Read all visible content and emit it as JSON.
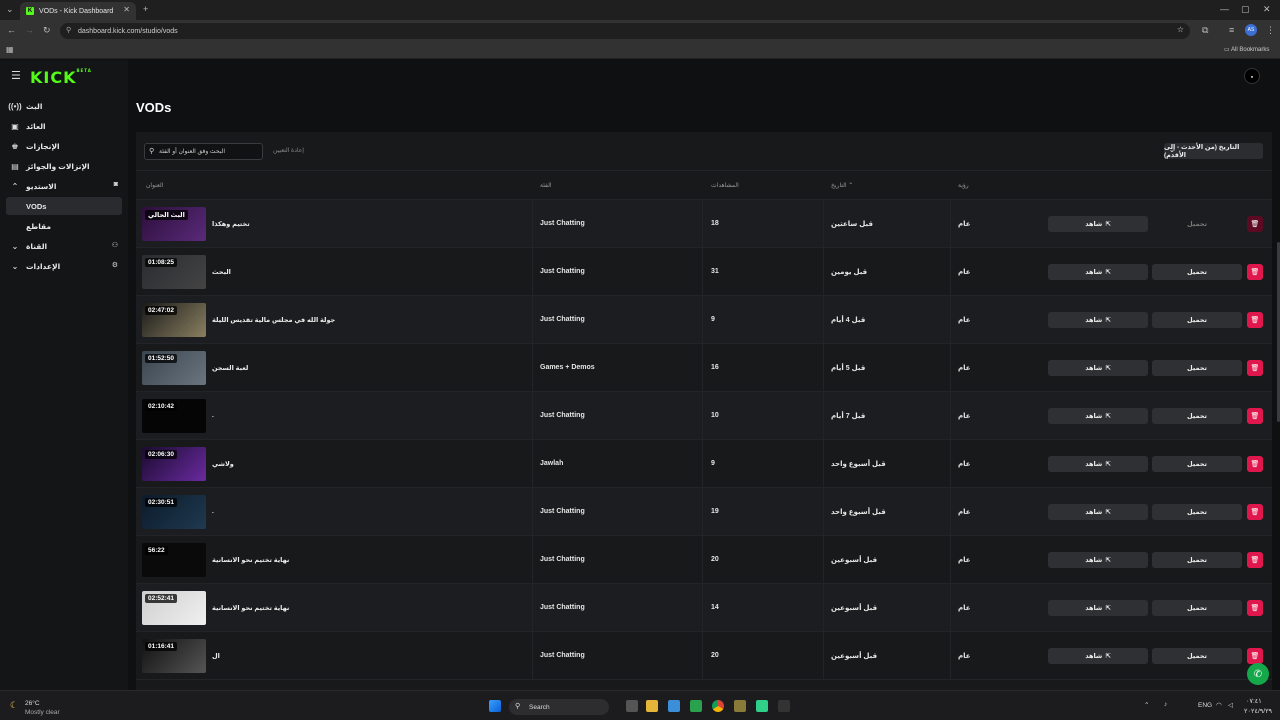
{
  "browser": {
    "tab_title": "VODs - Kick Dashboard",
    "url": "dashboard.kick.com/studio/vods",
    "bookmarks_label": "All Bookmarks",
    "profile_initials": "AS"
  },
  "logo": {
    "text": "KICK",
    "beta": "BETA"
  },
  "sidebar": {
    "items": [
      {
        "label": "البث",
        "icon": "broadcast-icon"
      },
      {
        "label": "العائد",
        "icon": "wallet-icon"
      },
      {
        "label": "الإنجازات",
        "icon": "trophy-icon"
      },
      {
        "label": "الإنزالات والجوائز",
        "icon": "gift-icon"
      },
      {
        "label": "الاستديو",
        "icon": "chevron-up-icon"
      },
      {
        "label": "VODs",
        "icon": ""
      },
      {
        "label": "مقاطع",
        "icon": ""
      },
      {
        "label": "القناة",
        "icon": "chevron-down-icon"
      },
      {
        "label": "الإعدادات",
        "icon": "chevron-down-icon"
      }
    ]
  },
  "main": {
    "title": "VODs",
    "search_placeholder": "البحث وفق العنوان أو الفئة",
    "reset_label": "إعادة التعيين",
    "sort_label": "التاريخ (من الأحدث - إلى الأقدم)",
    "columns": {
      "title": "العنوان",
      "category": "الفئة",
      "views": "المشاهدات",
      "date": "التاريخ",
      "visibility": "رؤية"
    },
    "watch_label": "شاهد",
    "download_label": "تحميل",
    "rows": [
      {
        "duration": "البث الحالي",
        "title": "تختيم وهكذا",
        "category": "Just Chatting",
        "views": "18",
        "date": "قبل ساعتين",
        "visibility": "عام",
        "download_disabled": true
      },
      {
        "duration": "01:08:25",
        "title": "البحث",
        "category": "Just Chatting",
        "views": "31",
        "date": "قبل يومين",
        "visibility": "عام"
      },
      {
        "duration": "02:47:02",
        "title": "جولة الله في مجلس مالية تقديس الليلة",
        "category": "Just Chatting",
        "views": "9",
        "date": "قبل 4 أيام",
        "visibility": "عام"
      },
      {
        "duration": "01:52:50",
        "title": "لعبة السجن",
        "category": "Games + Demos",
        "views": "16",
        "date": "قبل 5 أيام",
        "visibility": "عام"
      },
      {
        "duration": "02:10:42",
        "title": ".",
        "category": "Just Chatting",
        "views": "10",
        "date": "قبل 7 أيام",
        "visibility": "عام"
      },
      {
        "duration": "02:06:30",
        "title": "ولاشي",
        "category": "Jawlah",
        "views": "9",
        "date": "قبل أسبوع واحد",
        "visibility": "عام"
      },
      {
        "duration": "02:30:51",
        "title": ".",
        "category": "Just Chatting",
        "views": "19",
        "date": "قبل أسبوع واحد",
        "visibility": "عام"
      },
      {
        "duration": "56:22",
        "title": "نهاية تختيم نحو الانسانية",
        "category": "Just Chatting",
        "views": "20",
        "date": "قبل أسبوعين",
        "visibility": "عام"
      },
      {
        "duration": "02:52:41",
        "title": "نهاية تختيم نحو الانسانية",
        "category": "Just Chatting",
        "views": "14",
        "date": "قبل أسبوعين",
        "visibility": "عام"
      },
      {
        "duration": "01:16:41",
        "title": "ال",
        "category": "Just Chatting",
        "views": "20",
        "date": "قبل أسبوعين",
        "visibility": "عام"
      }
    ]
  },
  "taskbar": {
    "weather_temp": "26°C",
    "weather_desc": "Mostly clear",
    "search_label": "Search",
    "lang": "ENG",
    "time": "٠٧:٤١",
    "date": "٢٠٢٤/٩/٢٩"
  },
  "colors": {
    "accent": "#53fc18",
    "danger": "#e0174c",
    "help": "#14a84b"
  }
}
